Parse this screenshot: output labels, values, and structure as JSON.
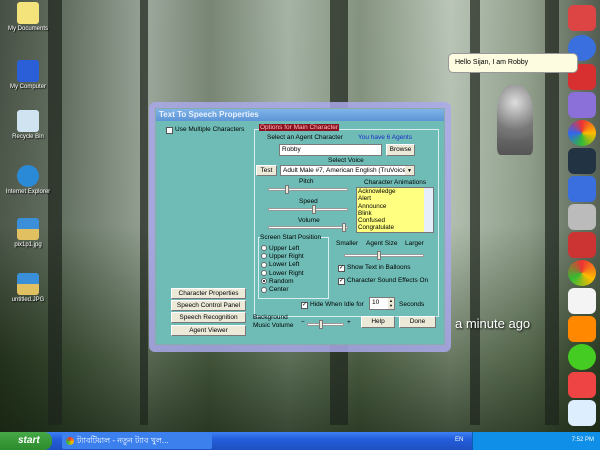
{
  "desktop": {
    "icons": [
      "My Documents",
      "My Computer",
      "Recycle Bin",
      "Internet Explorer",
      "pix1p1.jpg",
      "untitled.JPG"
    ],
    "clock_widget": "a minute ago"
  },
  "agent": {
    "balloon": "Hello Sijan, I am Robby"
  },
  "dialog": {
    "title": "Text To Speech Properties",
    "use_multiple": "Use Multiple Characters",
    "group_title": "Options for Main Character",
    "select_agent": "Select an Agent Character",
    "agents_count": "You have 6 Agents",
    "agent_value": "Robby",
    "browse": "Browse",
    "select_voice": "Select Voice",
    "test": "Test",
    "voice_value": "Adult Male #7, American English (TruVoice)",
    "pitch": "Pitch",
    "speed": "Speed",
    "volume": "Volume",
    "pitch_level": 0.23,
    "speed_level": 0.6,
    "volume_level": 1.0,
    "animations_label": "Character Animations",
    "animations": [
      "Acknowledge",
      "Alert",
      "Announce",
      "Blink",
      "Confused",
      "Congratulate"
    ],
    "position_title": "Screen Start Position",
    "positions": [
      "Upper Left",
      "Upper Right",
      "Lower Left",
      "Lower Right",
      "Random",
      "Center"
    ],
    "selected_position": "Random",
    "smaller": "Smaller",
    "agent_size": "Agent Size",
    "larger": "Larger",
    "size_level": 0.45,
    "show_text": "Show Text in Balloons",
    "sound_effects": "Character Sound Effects On",
    "hide_idle": "Hide When Idle for",
    "idle_value": "10",
    "seconds": "Seconds",
    "bg_music": "Background",
    "bg_music2": "Music Volume",
    "minus": "−",
    "plus": "+",
    "music_level": 0.4,
    "help": "Help",
    "done": "Done",
    "left_buttons": [
      "Character Properties",
      "Speech Control Panel",
      "Speech Recognition",
      "Agent Viewer"
    ]
  },
  "taskbar": {
    "start": "start",
    "task": "ট্যাবটিয়াল - নতুন ট্যাব খুল...",
    "lang": "EN",
    "time": "7:52 PM"
  }
}
